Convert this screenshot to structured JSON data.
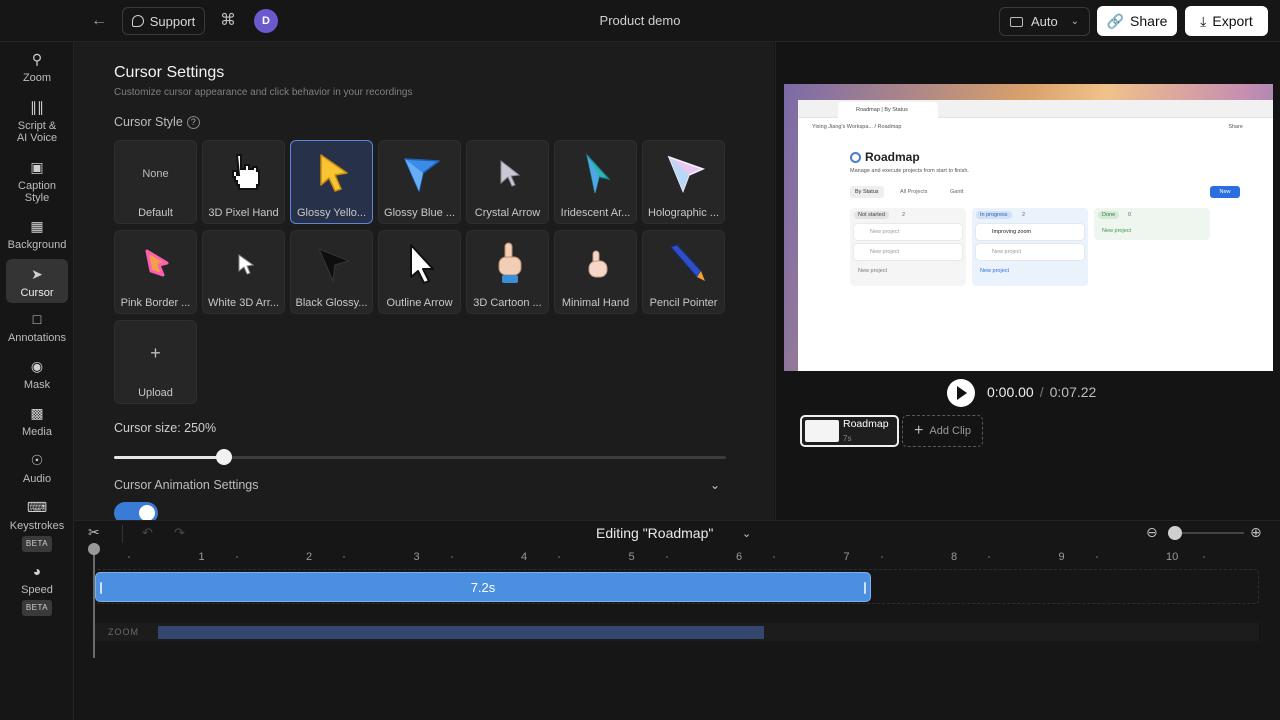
{
  "topbar": {
    "support_label": "Support",
    "avatar_initial": "D",
    "project_title": "Product demo",
    "layout_label": "Auto",
    "share_label": "Share",
    "export_label": "Export"
  },
  "sidebar": {
    "items": [
      {
        "label": "Zoom",
        "icon": "zoom-icon"
      },
      {
        "label": "Script &\nAI Voice",
        "icon": "waveform-icon"
      },
      {
        "label": "Caption\nStyle",
        "icon": "caption-icon"
      },
      {
        "label": "Background",
        "icon": "image-icon"
      },
      {
        "label": "Cursor",
        "icon": "cursor-icon",
        "active": true
      },
      {
        "label": "Annotations",
        "icon": "annotation-icon"
      },
      {
        "label": "Mask",
        "icon": "eye-icon"
      },
      {
        "label": "Media",
        "icon": "media-icon"
      },
      {
        "label": "Audio",
        "icon": "headphones-icon"
      },
      {
        "label": "Keystrokes",
        "icon": "keyboard-icon",
        "badge": "BETA"
      },
      {
        "label": "Speed",
        "icon": "speedometer-icon",
        "badge": "BETA"
      }
    ]
  },
  "settings": {
    "title": "Cursor Settings",
    "subtitle": "Customize cursor appearance and click behavior in your recordings",
    "style_label": "Cursor Style",
    "help_glyph": "?",
    "cursors": [
      {
        "label": "Default",
        "preview": "None"
      },
      {
        "label": "3D Pixel Hand"
      },
      {
        "label": "Glossy Yello...",
        "selected": true
      },
      {
        "label": "Glossy Blue ..."
      },
      {
        "label": "Crystal Arrow"
      },
      {
        "label": "Iridescent Ar..."
      },
      {
        "label": "Holographic ..."
      },
      {
        "label": "Pink Border ..."
      },
      {
        "label": "White 3D Arr..."
      },
      {
        "label": "Black Glossy..."
      },
      {
        "label": "Outline Arrow"
      },
      {
        "label": "3D Cartoon ..."
      },
      {
        "label": "Minimal Hand"
      },
      {
        "label": "Pencil Pointer"
      },
      {
        "label": "Upload",
        "preview": "+"
      }
    ],
    "size_label": "Cursor size: 250%",
    "size_fraction": 0.18,
    "animation_label": "Cursor Animation Settings",
    "animation_toggle_on": true
  },
  "preview": {
    "tab_title": "Roadmap | By Status",
    "workspace_crumb": "Yixing Jiang's Workspa...  /  Roadmap",
    "page_share": "Share",
    "heading": "Roadmap",
    "description": "Manage and execute projects from start to finish.",
    "views": [
      "By Status",
      "All Projects",
      "Gantt"
    ],
    "new_button": "New",
    "columns": [
      {
        "status": "Not started",
        "count": "2",
        "cards": [
          "New project",
          "New project"
        ],
        "add": "New project"
      },
      {
        "status": "In progress",
        "count": "2",
        "cards": [
          "Improving zoom",
          "New project"
        ],
        "add": "New project"
      },
      {
        "status": "Done",
        "count": "0",
        "cards": [],
        "add": "New project"
      }
    ],
    "current_time": "0:00.00",
    "time_separator": "/",
    "total_time": "0:07.22",
    "clip_name": "Roadmap",
    "clip_duration": "7s",
    "add_clip_label": "Add Clip"
  },
  "timeline": {
    "editing_label": "Editing \"Roadmap\"",
    "ruler_labels": [
      "1",
      "2",
      "3",
      "4",
      "5",
      "6",
      "7",
      "8",
      "9",
      "10"
    ],
    "clip_label": "7.2s",
    "zoom_track_label": "ZOOM"
  },
  "colors": {
    "accent": "#4a8fe0",
    "selected_card": "#5d86d8",
    "avatar": "#6a5acd"
  }
}
